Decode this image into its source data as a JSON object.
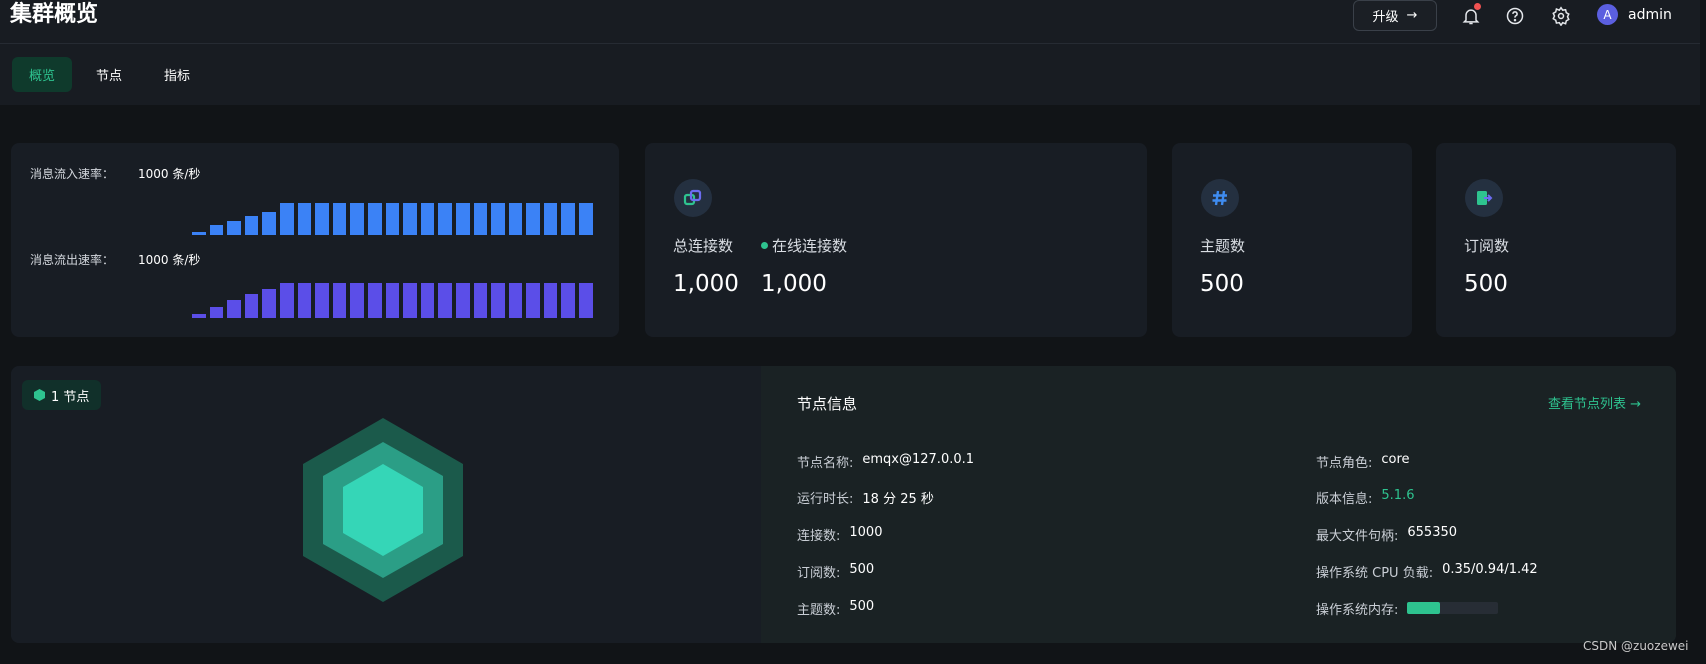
{
  "header": {
    "title": "集群概览",
    "upgrade_label": "升级",
    "avatar_letter": "A",
    "username": "admin"
  },
  "tabs": [
    {
      "label": "概览",
      "active": true
    },
    {
      "label": "节点",
      "active": false
    },
    {
      "label": "指标",
      "active": false
    }
  ],
  "rates": {
    "in_label": "消息流入速率：",
    "in_value": "1000 条/秒",
    "out_label": "消息流出速率：",
    "out_value": "1000 条/秒",
    "in_series": [
      0.1,
      0.3,
      0.45,
      0.6,
      0.72,
      1,
      1,
      1,
      1,
      1,
      1,
      1,
      1,
      1,
      1,
      1,
      1,
      1,
      1,
      1,
      1,
      1,
      1
    ],
    "out_series": [
      0.1,
      0.3,
      0.5,
      0.68,
      0.82,
      1,
      1,
      1,
      1,
      1,
      1,
      1,
      1,
      1,
      1,
      1,
      1,
      1,
      1,
      1,
      1,
      1,
      1
    ]
  },
  "stats": {
    "connections_label": "总连接数",
    "connections_value": "1,000",
    "online_label": "在线连接数",
    "online_value": "1,000",
    "topics_label": "主题数",
    "topics_value": "500",
    "subs_label": "订阅数",
    "subs_value": "500"
  },
  "node": {
    "badge": "1 节点",
    "info_title": "节点信息",
    "list_link": "查看节点列表",
    "left": [
      {
        "k": "节点名称:",
        "v": "emqx@127.0.0.1"
      },
      {
        "k": "运行时长:",
        "v": "18 分 25 秒"
      },
      {
        "k": "连接数:",
        "v": "1000"
      },
      {
        "k": "订阅数:",
        "v": "500"
      },
      {
        "k": "主题数:",
        "v": "500"
      }
    ],
    "right": [
      {
        "k": "节点角色:",
        "v": "core"
      },
      {
        "k": "版本信息:",
        "v": "5.1.6"
      },
      {
        "k": "最大文件句柄:",
        "v": "655350"
      },
      {
        "k": "操作系统 CPU 负载:",
        "v": "0.35/0.94/1.42"
      }
    ],
    "memory_label": "操作系统内存:",
    "memory_fraction": 0.36
  },
  "watermark": "CSDN @zuozewei",
  "colors": {
    "accent": "#2ec38f",
    "in_bar": "#3b82f6",
    "out_bar": "#5b4ee8"
  }
}
